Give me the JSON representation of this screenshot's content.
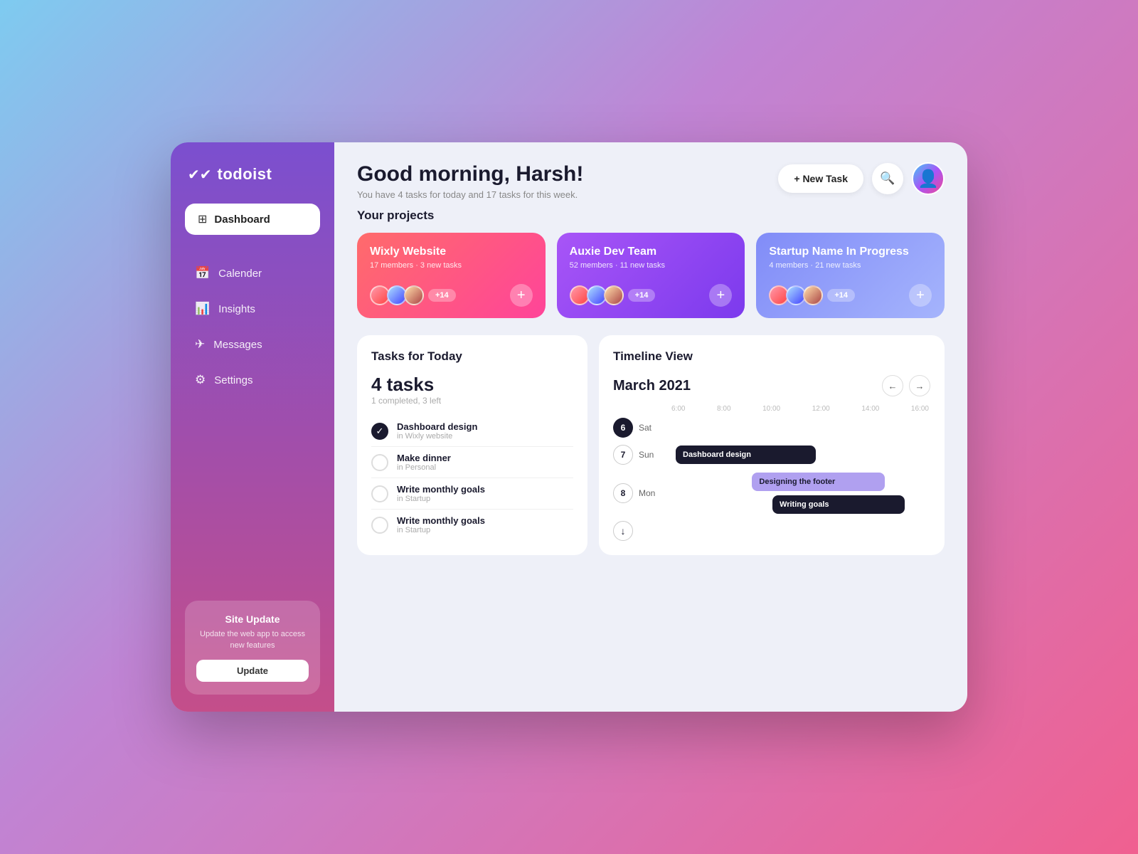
{
  "app": {
    "name": "todoist",
    "logo_icon": "✓✓"
  },
  "sidebar": {
    "dashboard_label": "Dashboard",
    "nav_items": [
      {
        "id": "calendar",
        "label": "Calender",
        "icon": "📅"
      },
      {
        "id": "insights",
        "label": "Insights",
        "icon": "📊"
      },
      {
        "id": "messages",
        "label": "Messages",
        "icon": "✈"
      },
      {
        "id": "settings",
        "label": "Settings",
        "icon": "⚙"
      }
    ],
    "update_card": {
      "title": "Site Update",
      "desc": "Update the web app to access new features",
      "btn_label": "Update"
    }
  },
  "header": {
    "greeting": "Good morning, Harsh!",
    "subtitle": "You have 4 tasks for today and 17 tasks for this week.",
    "new_task_label": "+ New Task"
  },
  "projects": {
    "section_title": "Your projects",
    "items": [
      {
        "name": "Wixly Website",
        "meta": "17 members · 3 new tasks",
        "members_extra": "+14",
        "color": "card-1"
      },
      {
        "name": "Auxie Dev Team",
        "meta": "52 members · 11 new tasks",
        "members_extra": "+14",
        "color": "card-2"
      },
      {
        "name": "Startup Name In Progress",
        "meta": "4 members · 21 new tasks",
        "members_extra": "+14",
        "color": "card-3"
      }
    ]
  },
  "tasks": {
    "section_title": "Tasks for Today",
    "count": "4 tasks",
    "completed_text": "1 completed, 3 left",
    "items": [
      {
        "name": "Dashboard design",
        "project": "in Wixly website",
        "checked": true
      },
      {
        "name": "Make dinner",
        "project": "in Personal",
        "checked": false
      },
      {
        "name": "Write monthly goals",
        "project": "in Startup",
        "checked": false
      },
      {
        "name": "Write monthly goals",
        "project": "in Startup",
        "checked": false
      }
    ]
  },
  "timeline": {
    "section_title": "Timeline View",
    "month": "March 2021",
    "time_labels": [
      "6:00",
      "8:00",
      "10:00",
      "12:00",
      "14:00",
      "16:00"
    ],
    "rows": [
      {
        "day_num": "6",
        "day_label": "Sat",
        "style": "active",
        "bars": []
      },
      {
        "day_num": "7",
        "day_label": "Sun",
        "style": "outlined",
        "bars": [
          {
            "label": "Dashboard design",
            "class": "bar-dashboard"
          }
        ]
      },
      {
        "day_num": "8",
        "day_label": "Mon",
        "style": "outlined",
        "bars": [
          {
            "label": "Designing the footer",
            "class": "bar-footer"
          },
          {
            "label": "Writing goals",
            "class": "bar-writing"
          }
        ]
      },
      {
        "day_num": "↓",
        "day_label": "",
        "style": "download",
        "bars": []
      }
    ]
  }
}
